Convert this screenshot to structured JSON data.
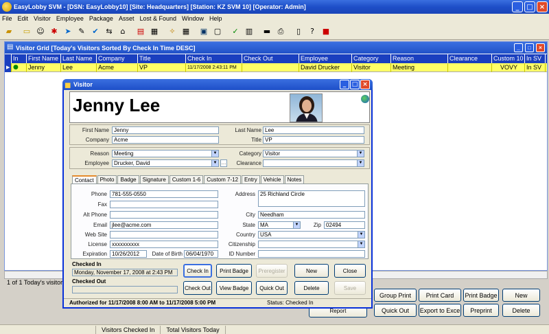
{
  "window": {
    "title": "EasyLobby SVM - [DSN: EasyLobby10] [Site: Headquarters] [Station: KZ SVM 10] [Operator: Admin]"
  },
  "menu": [
    "File",
    "Edit",
    "Visitor",
    "Employee",
    "Package",
    "Asset",
    "Lost & Found",
    "Window",
    "Help"
  ],
  "grid": {
    "title": "Visitor Grid  [Today's Visitors Sorted By Check In Time DESC]",
    "columns": [
      "In",
      "First Name",
      "Last Name",
      "Company",
      "Title",
      "Check In",
      "Check Out",
      "Employee",
      "Category",
      "Reason",
      "Clearance",
      "Custom 10",
      "In SV"
    ],
    "row": [
      "Jenny",
      "Lee",
      "Acme",
      "VP",
      "11/17/2008 2:43:11 PM",
      "",
      "David Drucker",
      "Visitor",
      "Meeting",
      "",
      "VOVY",
      "In SV"
    ],
    "count_text": "1 of 1 Today's visitors"
  },
  "main_buttons": {
    "group_print": "Group Print",
    "print_card": "Print Card",
    "print_badge": "Print Badge",
    "new": "New",
    "quick_out": "Quick Out",
    "export_to_excel": "Export to Exce",
    "preprint": "Preprint",
    "delete": "Delete",
    "hidden": "Report"
  },
  "statusbar": [
    "Visitors Checked In",
    "Total Visitors Today"
  ],
  "dialog": {
    "title": "Visitor",
    "full_name": "Jenny Lee",
    "labels": {
      "first_name": "First Name",
      "last_name": "Last Name",
      "company": "Company",
      "title": "Title",
      "reason": "Reason",
      "category": "Category",
      "employee": "Employee",
      "clearance": "Clearance",
      "phone": "Phone",
      "fax": "Fax",
      "alt_phone": "Alt Phone",
      "email": "Email",
      "web_site": "Web Site",
      "license": "License",
      "expiration": "Expiration",
      "date_of_birth": "Date of Birth",
      "address": "Address",
      "city": "City",
      "state": "State",
      "zip": "Zip",
      "country": "Country",
      "citizenship": "Citizenship",
      "id_number": "ID Number"
    },
    "values": {
      "first_name": "Jenny",
      "last_name": "Lee",
      "company": "Acme",
      "title": "VP",
      "reason": "Meeting",
      "category": "Visitor",
      "employee": "Drucker, David",
      "clearance": "",
      "phone": "781-555-0550",
      "fax": "",
      "alt_phone": "",
      "email": "jlee@acme.com",
      "web_site": "",
      "license": "xxxxxxxxxx",
      "expiration": "10/26/2012",
      "date_of_birth": "06/04/1970",
      "address": "25 Richland Circle",
      "city": "Needham",
      "state": "MA",
      "zip": "02494",
      "country": "USA",
      "citizenship": "",
      "id_number": ""
    },
    "tabs": [
      "Contact",
      "Photo",
      "Badge",
      "Signature",
      "Custom 1-6",
      "Custom 7-12",
      "Entry",
      "Vehicle",
      "Notes"
    ],
    "checked_in_label": "Checked In",
    "checked_in_value": "Monday, November 17, 2008 at 2:43 PM",
    "checked_out_label": "Checked Out",
    "checked_out_value": "",
    "buttons": {
      "check_in": "Check In",
      "print_badge": "Print Badge",
      "preregister": "Preregister",
      "new": "New",
      "close": "Close",
      "check_out": "Check Out",
      "view_badge": "View Badge",
      "quick_out": "Quick Out",
      "delete": "Delete",
      "save": "Save"
    },
    "authorized": "Authorized for 11/17/2008 8:00 AM to 11/17/2008 5:00 PM",
    "status": "Status: Checked In"
  },
  "colors": {
    "title_blue": "#1e4fc8",
    "grid_header": "#1a3fbf",
    "row_highlight": "#ffff66",
    "close_red": "#e04a2a"
  }
}
